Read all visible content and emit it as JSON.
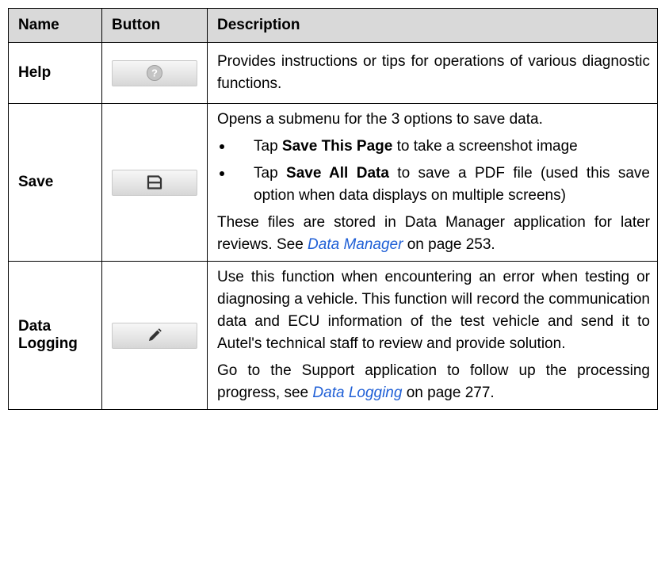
{
  "headers": {
    "name": "Name",
    "button": "Button",
    "description": "Description"
  },
  "icons": {
    "help": "help-circle-icon",
    "save": "save-floppy-icon",
    "logging": "pencil-icon"
  },
  "rows": {
    "help": {
      "name": "Help",
      "desc": "Provides instructions or tips for operations of various diagnostic functions."
    },
    "save": {
      "name": "Save",
      "intro": "Opens a submenu for the 3 options to save data.",
      "bullet1_pre": "Tap ",
      "bullet1_bold": "Save This Page",
      "bullet1_post": " to take a screenshot image",
      "bullet2_pre": "Tap ",
      "bullet2_bold": "Save All Data",
      "bullet2_post": " to save a PDF file (used this save option when data displays on multiple screens)",
      "outro_pre": "These files are stored in Data Manager application for later reviews. See ",
      "outro_link": "Data Manager",
      "outro_post": " on page 253."
    },
    "logging": {
      "name_line1": "Data",
      "name_line2": "Logging",
      "para1": "Use this function when encountering an error when testing or diagnosing a vehicle. This function will record the communication data and ECU information of the test vehicle and send it to Autel's technical staff to review and provide solution.",
      "para2_pre": "Go to the Support application to follow up the processing progress, see ",
      "para2_link": "Data Logging",
      "para2_post": " on page 277."
    }
  }
}
